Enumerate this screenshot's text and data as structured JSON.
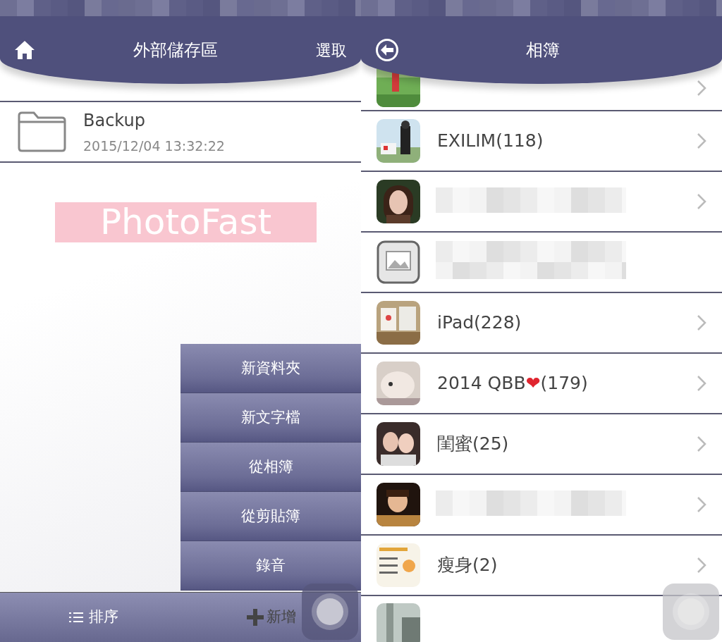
{
  "left_screen": {
    "header": {
      "title": "外部儲存區",
      "action": "選取"
    },
    "files": [
      {
        "name": "Backup",
        "date": "2015/12/04 13:32:22"
      }
    ],
    "banner": "PhotoFast",
    "add_menu": [
      "新資料夾",
      "新文字檔",
      "從相簿",
      "從剪貼簿",
      "錄音"
    ],
    "toolbar": [
      {
        "kind": "sort",
        "label": "排序"
      },
      {
        "kind": "add",
        "label": "新增"
      }
    ]
  },
  "right_screen": {
    "header": {
      "title": "相簿"
    },
    "albums": [
      {
        "kind": "cut"
      },
      {
        "kind": "album",
        "title": "EXILIM(118)"
      },
      {
        "kind": "blurred"
      },
      {
        "kind": "blurred_two_line"
      },
      {
        "kind": "album",
        "title": "iPad(228)"
      },
      {
        "kind": "album",
        "title": "2014 QBB",
        "emoji": "❤",
        "title_after": "(179)"
      },
      {
        "kind": "album",
        "title": "閨蜜(25)"
      },
      {
        "kind": "blurred"
      },
      {
        "kind": "album",
        "title": "瘦身(2)"
      },
      {
        "kind": "cut_bottom"
      }
    ]
  }
}
